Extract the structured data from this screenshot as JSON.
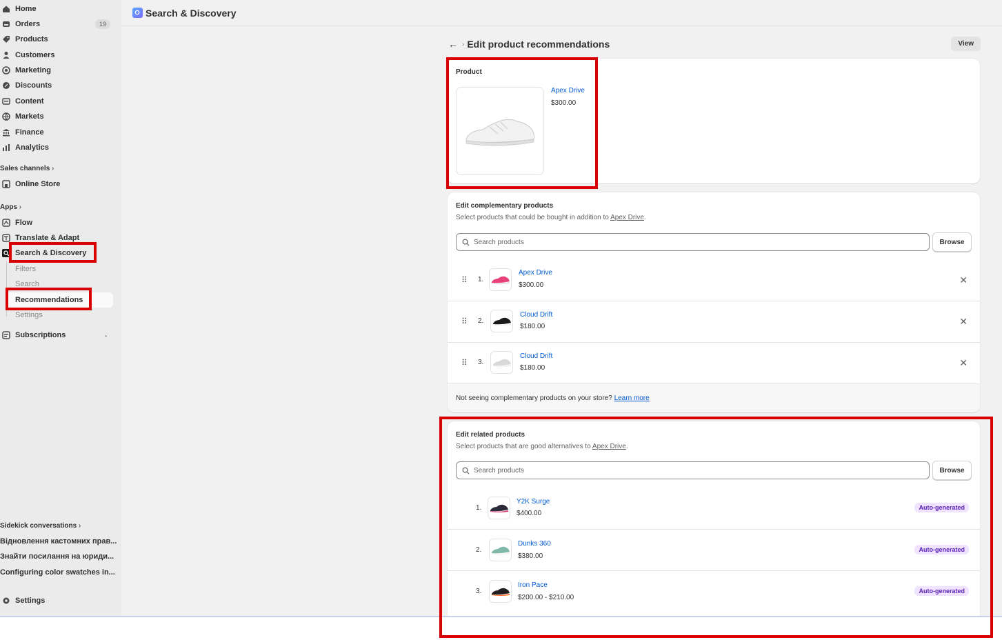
{
  "sidebar": {
    "items": [
      {
        "label": "Home",
        "icon": "home-icon"
      },
      {
        "label": "Orders",
        "icon": "orders-icon",
        "count": "19"
      },
      {
        "label": "Products",
        "icon": "tag-icon"
      },
      {
        "label": "Customers",
        "icon": "person-icon"
      },
      {
        "label": "Marketing",
        "icon": "target-icon"
      },
      {
        "label": "Discounts",
        "icon": "discount-icon"
      },
      {
        "label": "Content",
        "icon": "content-icon"
      },
      {
        "label": "Markets",
        "icon": "globe-icon"
      },
      {
        "label": "Finance",
        "icon": "bank-icon"
      },
      {
        "label": "Analytics",
        "icon": "chart-icon"
      }
    ],
    "sales_channels_label": "Sales channels",
    "online_store_label": "Online Store",
    "apps_label": "Apps",
    "apps": [
      {
        "label": "Flow",
        "icon": "flow-icon"
      },
      {
        "label": "Translate & Adapt",
        "icon": "translate-icon"
      },
      {
        "label": "Search & Discovery",
        "icon": "search-discovery-icon"
      }
    ],
    "sub_items": [
      "Filters",
      "Search",
      "Recommendations",
      "Settings"
    ],
    "subscriptions_label": "Subscriptions",
    "sidekick_label": "Sidekick conversations",
    "conversations": [
      "Відновлення кастомних прав...",
      "Знайти посилання на юриди...",
      "Configuring color swatches in..."
    ],
    "settings_label": "Settings"
  },
  "topbar": {
    "title": "Search & Discovery"
  },
  "page": {
    "title": "Edit product recommendations",
    "view_label": "View"
  },
  "product_card": {
    "title": "Product",
    "name": "Apex Drive",
    "price": "$300.00"
  },
  "complementary": {
    "title": "Edit complementary products",
    "subtitle_prefix": "Select products that could be bought in addition to ",
    "subtitle_link": "Apex Drive",
    "subtitle_suffix": ".",
    "search_placeholder": "Search products",
    "browse_label": "Browse",
    "items": [
      {
        "num": "1.",
        "name": "Apex Drive",
        "price": "$300.00",
        "shoe_color": "#e8407a"
      },
      {
        "num": "2.",
        "name": "Cloud Drift",
        "price": "$180.00",
        "shoe_color": "#1a1a1a"
      },
      {
        "num": "3.",
        "name": "Cloud Drift",
        "price": "$180.00",
        "shoe_color": "#d9d9d9"
      }
    ],
    "footer_text": "Not seeing complementary products on your store? ",
    "footer_link": "Learn more"
  },
  "related": {
    "title": "Edit related products",
    "subtitle_prefix": "Select products that are good alternatives to ",
    "subtitle_link": "Apex Drive",
    "subtitle_suffix": ".",
    "search_placeholder": "Search products",
    "browse_label": "Browse",
    "badge_label": "Auto-generated",
    "items": [
      {
        "num": "1.",
        "name": "Y2K Surge",
        "price": "$400.00",
        "shoe_color": "#2b2b3a"
      },
      {
        "num": "2.",
        "name": "Dunks 360",
        "price": "$380.00",
        "shoe_color": "#7fb8a8"
      },
      {
        "num": "3.",
        "name": "Iron Pace",
        "price": "$200.00 - $210.00",
        "shoe_color": "#ff6a2a"
      }
    ]
  },
  "colors": {
    "link": "#005bd3",
    "annotation": "#d90000",
    "badge_bg": "#efe3ff"
  }
}
